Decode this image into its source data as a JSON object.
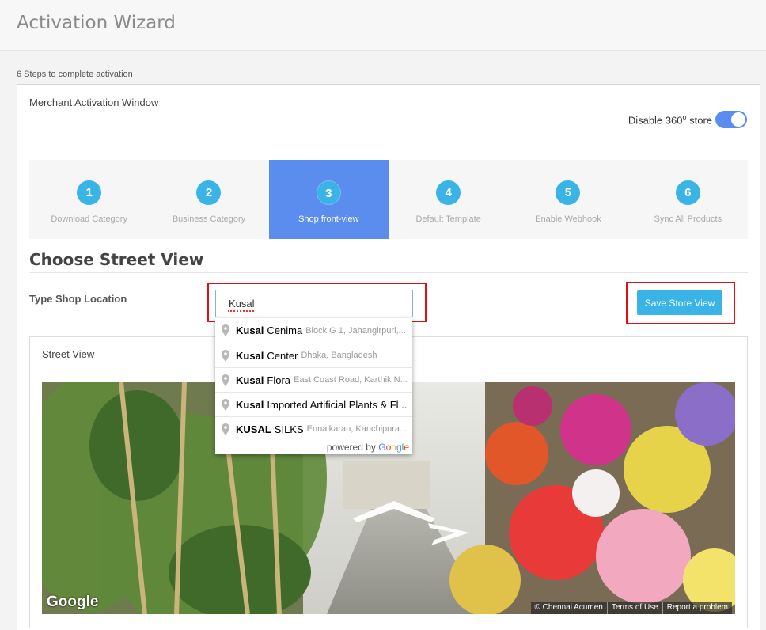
{
  "header": {
    "title": "Activation Wizard"
  },
  "wizard": {
    "caption": "6 Steps to complete activation"
  },
  "card": {
    "title": "Merchant Activation Window",
    "toggle": {
      "label": "Disable 360",
      "superscript": "o",
      "label_suffix": " store",
      "on": true
    }
  },
  "steps": [
    {
      "num": "1",
      "label": "Download Category",
      "active": false
    },
    {
      "num": "2",
      "label": "Business Category",
      "active": false
    },
    {
      "num": "3",
      "label": "Shop front-view",
      "active": true
    },
    {
      "num": "4",
      "label": "Default Template",
      "active": false
    },
    {
      "num": "5",
      "label": "Enable Webhook",
      "active": false
    },
    {
      "num": "6",
      "label": "Sync All Products",
      "active": false
    }
  ],
  "section": {
    "title": "Choose Street View"
  },
  "location": {
    "label": "Type Shop Location",
    "value": "Kusal",
    "save_label": "Save Store View"
  },
  "suggestions": [
    {
      "match": "Kusal",
      "rest": "Cenima",
      "secondary": "Block G 1, Jahangirpuri,..."
    },
    {
      "match": "Kusal",
      "rest": "Center",
      "secondary": "Dhaka, Bangladesh"
    },
    {
      "match": "Kusal",
      "rest": "Flora",
      "secondary": "East Coast Road, Karthik N..."
    },
    {
      "match": "Kusal",
      "rest": "Imported Artificial Plants & Fl...",
      "secondary": ""
    },
    {
      "match": "KUSAL",
      "rest": "SILKS",
      "secondary": "Ennaikaran, Kanchipura..."
    }
  ],
  "powered_by": {
    "prefix": "powered by ",
    "brand": "Google"
  },
  "street_view": {
    "title": "Street View",
    "logo": "Google",
    "attribution": [
      "© Chennai Acumen",
      "Terms of Use",
      "Report a problem"
    ]
  },
  "colors": {
    "accent": "#5b8def",
    "step_circle": "#3ab4e6",
    "highlight_frame": "#dd1111"
  },
  "icons": {
    "suggestion": "map-pin-icon",
    "nav": "chevron-arrow-icon"
  }
}
